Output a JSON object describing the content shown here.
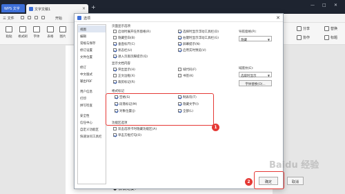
{
  "titlebar": {
    "app_tab": "WPS 文字",
    "doc_tab": "文字文稿1",
    "add_tab": "+"
  },
  "window_controls": {
    "minimize": "—",
    "maximize": "□",
    "close": "✕"
  },
  "menubar": {
    "file": "三 文件",
    "items": [
      "开始",
      "插入",
      "页面布局",
      "引用",
      "审阅",
      "视图",
      "章节",
      "开发工具",
      "特色应用",
      "查找"
    ]
  },
  "toolbar": {
    "tools": [
      "粘贴",
      "格式刷",
      "字体",
      "表格",
      "图片",
      "形状",
      "文本框",
      "艺术字"
    ],
    "right": [
      "文本工具",
      "替换",
      "选择",
      "标题"
    ],
    "share": "分享",
    "collab": "协作"
  },
  "dialog": {
    "title": "选项",
    "close": "✕",
    "nav": [
      "视图",
      "编辑",
      "常规与保存",
      "修订设置",
      "文件位置",
      "修订",
      "中文版式",
      "输出PDF",
      "用户信息",
      "打印",
      "拼写检查",
      "安全性",
      "信任中心",
      "自定义功能区",
      "快速访问工具栏"
    ],
    "section_page_display": "页面显示选项",
    "page_display_col1": [
      {
        "label": "启动时展开任务窗格(R)",
        "checked": false
      },
      {
        "label": "隐藏空白(B)",
        "checked": false
      },
      {
        "label": "垂直标尺(C)",
        "checked": true
      },
      {
        "label": "状态栏(U)",
        "checked": true
      },
      {
        "label": "进入页眉页脚提示(Q)",
        "checked": true
      }
    ],
    "page_display_col2": [
      {
        "label": "选择时显示浮动工具栏(D)",
        "checked": true
      },
      {
        "label": "右键时显示浮动工具栏(G)",
        "checked": true
      },
      {
        "label": "屏幕提示(N)",
        "checked": true
      },
      {
        "label": "启用实时预览(V)",
        "checked": true
      }
    ],
    "nav_pane_label": "导航窗格(P):",
    "nav_pane_value": "隐藏",
    "section_display_format": "显示文档内容",
    "display_col1": [
      {
        "label": "突出显示(H)",
        "checked": true
      },
      {
        "label": "正文边框(X)",
        "checked": false
      },
      {
        "label": "裁剪标记(R)",
        "checked": true
      }
    ],
    "display_col2": [
      {
        "label": "域代码(F)",
        "checked": false
      },
      {
        "label": "书签(K)",
        "checked": false
      }
    ],
    "field_shading_label": "域底纹(E):",
    "field_shading_value": "选取时显示",
    "font_replace_button": "字体替换(O)...",
    "section_format_marks": "格式标记",
    "marks_col1": [
      {
        "label": "空格(S)",
        "checked": true
      },
      {
        "label": "段落标记(M)",
        "checked": true
      },
      {
        "label": "对象位置(J)",
        "checked": true
      }
    ],
    "marks_col2": [
      {
        "label": "制表符(T)",
        "checked": true
      },
      {
        "label": "隐藏文字(I)",
        "checked": true
      },
      {
        "label": "全部(L)",
        "checked": true
      }
    ],
    "section_function_marks": "功能区选项",
    "function_opts": [
      {
        "label": "双击选项卡时隐藏功能区(A)",
        "checked": false
      },
      {
        "label": "单击方框打勾(O)",
        "checked": true
      }
    ],
    "ok": "确定",
    "cancel": "取消"
  },
  "document": {
    "bullet_text": "● 会议纪要:"
  },
  "annotations": {
    "badge1": "1",
    "badge2": "2"
  },
  "watermark": "Baidu 经验"
}
